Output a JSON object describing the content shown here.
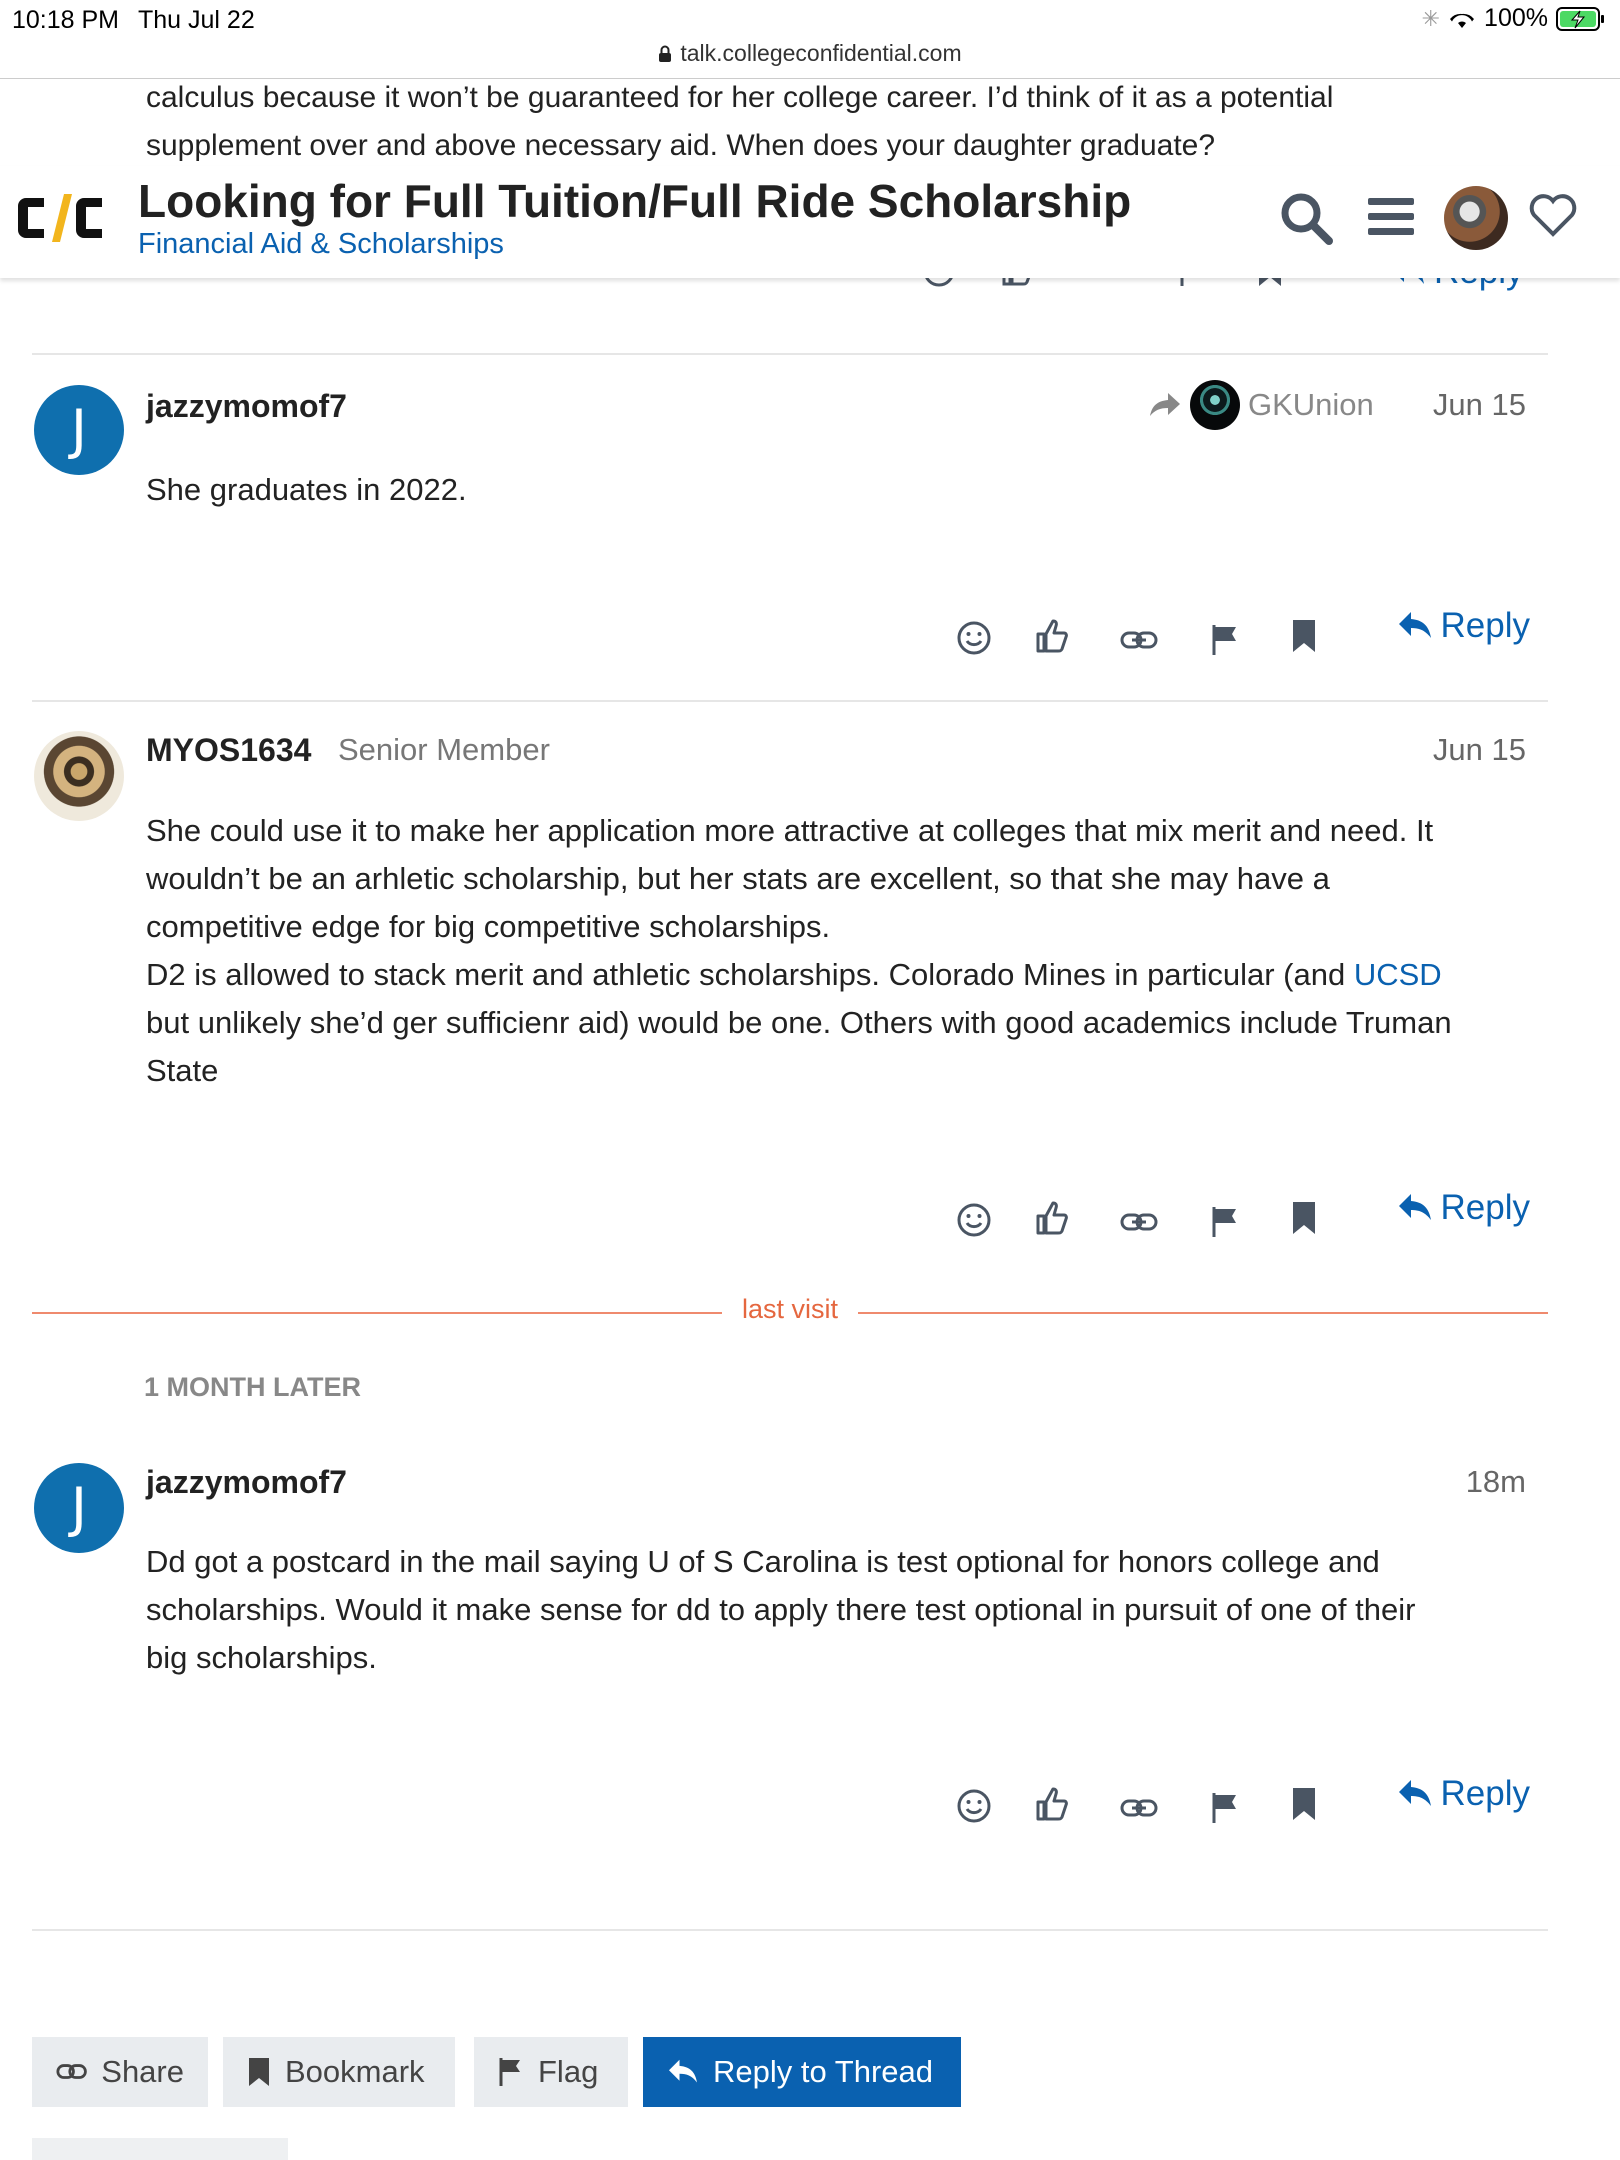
{
  "status_bar": {
    "time": "10:18 PM",
    "date": "Thu Jul 22",
    "battery": "100%",
    "url": "talk.collegeconfidential.com"
  },
  "scrolled_text": [
    "calculus because it won’t be guaranteed for her college career. I’d think of it as a potential",
    "supplement over and above necessary aid. When does your daughter graduate?"
  ],
  "header": {
    "logo_text": "C/C",
    "title": "Looking for Full Tuition/Full Ride Scholarship",
    "category": "Financial Aid & Scholarships",
    "category_color": "#0a61b0"
  },
  "peek_reply_label": "Reply",
  "posts": [
    {
      "avatar_letter": "J",
      "username": "jazzymomof7",
      "reply_to": "GKUnion",
      "date": "Jun 15",
      "body": [
        "She graduates in 2022."
      ],
      "reply_label": "Reply"
    },
    {
      "username": "MYOS1634",
      "user_title": "Senior Member",
      "date": "Jun 15",
      "body": [
        "She could use it to make her application more attractive at colleges that mix merit and need. It",
        "wouldn’t be an arhletic scholarship, but her stats are excellent, so that she may have a",
        "competitive edge for big competitive scholarships.",
        "D2 is allowed to stack merit and athletic scholarships. Colorado Mines in particular (and ",
        "but unlikely she’d ger sufficienr aid) would be one. Others with good academics include Truman",
        "State"
      ],
      "body_link": "UCSD",
      "reply_label": "Reply"
    },
    {
      "avatar_letter": "J",
      "username": "jazzymomof7",
      "date": "18m",
      "body": [
        "Dd got a postcard in the mail saying U of S Carolina is test optional for honors college and",
        "scholarships. Would it make sense for dd to apply there test optional in pursuit of one of their",
        "big scholarships."
      ],
      "reply_label": "Reply"
    }
  ],
  "last_visit_label": "last visit",
  "time_gap_label": "1 MONTH LATER",
  "footer_buttons": {
    "share": "Share",
    "bookmark": "Bookmark",
    "flag": "Flag",
    "reply_to_thread": "Reply to Thread"
  },
  "colors": {
    "link": "#0a61b0",
    "avatar_j": "#0f6fae",
    "last_visit": "#e5673f",
    "action_icon": "#4a5563"
  }
}
